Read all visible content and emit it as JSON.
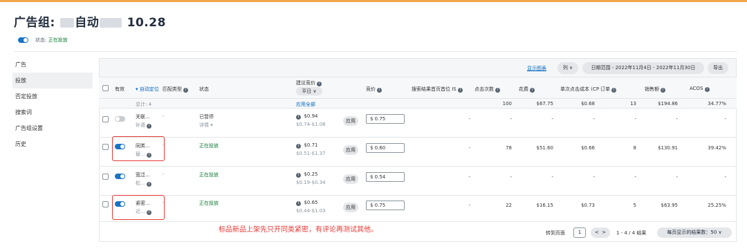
{
  "header": {
    "title_prefix": "广告组: ",
    "title_mid": "自动",
    "title_suffix": "10.28",
    "status_label": "状态: ",
    "status_value": "正在投放"
  },
  "sidebar": {
    "items": [
      {
        "label": "广告",
        "active": false
      },
      {
        "label": "投放",
        "active": true
      },
      {
        "label": "否定投放",
        "active": false
      },
      {
        "label": "搜索词",
        "active": false
      },
      {
        "label": "广告组设置",
        "active": false
      },
      {
        "label": "历史",
        "active": false
      }
    ]
  },
  "toolbar": {
    "show_chart": "显示图表",
    "columns": "列",
    "date_range": "日期范围 - 2022年11月4日 - 2022年11月30日",
    "export": "导出"
  },
  "table": {
    "headers": {
      "active": "有效",
      "auto_targeting": "▾ 自动定位",
      "match_type": "匹配类型",
      "status": "状态",
      "suggested_bid": "建议竞价",
      "bid_dropdown": "平日 ∨",
      "bid": "竞价",
      "top_of_search": "搜索结果首页首位 IS",
      "clicks": "点击次数",
      "spend": "花费",
      "cpc": "单次点击成本 (CPC)",
      "orders": "订单",
      "sales": "销售额",
      "acos": "ACOS"
    },
    "total": {
      "label": "总计: 4",
      "apply_all": "应用全部",
      "clicks": "100",
      "spend": "$67.75",
      "cpc": "$0.68",
      "orders": "13",
      "sales": "$194.86",
      "acos": "34.77%"
    },
    "rows": [
      {
        "active": false,
        "name1": "关联...",
        "name2": "补语",
        "match": "-",
        "status": "已暂停",
        "status_sub": "详情 ▾",
        "sug_bid": "$0.94",
        "sug_range": "$0.74-$1.08",
        "apply": "应用",
        "bid": "$  0.75",
        "top": "-",
        "clicks": "-",
        "spend": "-",
        "cpc": "-",
        "orders": "-",
        "sales": "-",
        "acos": "-"
      },
      {
        "active": true,
        "name1": "同类...",
        "name2": "替...",
        "match": "-",
        "status": "正在投放",
        "status_sub": "",
        "sug_bid": "$0.71",
        "sug_range": "$0.51-$1.37",
        "apply": "应用",
        "bid": "$  0.60",
        "top": "-",
        "clicks": "78",
        "spend": "$51.60",
        "cpc": "$0.66",
        "orders": "8",
        "sales": "$130.91",
        "acos": "39.42%"
      },
      {
        "active": true,
        "name1": "宽泛...",
        "name2": "松...",
        "match": "-",
        "status": "正在投放",
        "status_sub": "",
        "sug_bid": "$0.25",
        "sug_range": "$0.19-$0.34",
        "apply": "应用",
        "bid": "$  0.54",
        "top": "-",
        "clicks": "-",
        "spend": "-",
        "cpc": "-",
        "orders": "-",
        "sales": "-",
        "acos": "-"
      },
      {
        "active": true,
        "name1": "紧密...",
        "name2": "近...",
        "match": "-",
        "status": "正在投放",
        "status_sub": "",
        "sug_bid": "$0.65",
        "sug_range": "$0.44-$1.03",
        "apply": "应用",
        "bid": "$  0.75",
        "top": "-",
        "clicks": "22",
        "spend": "$16.15",
        "cpc": "$0.73",
        "orders": "5",
        "sales": "$63.95",
        "acos": "25.25%"
      }
    ]
  },
  "annotation": "标品新品上架先只开同类紧密，有评论再测试其他。",
  "pagination": {
    "goto_label": "转到页面",
    "page": "1",
    "prev": "<",
    "next": ">",
    "range": "1 - 4 / 4 结果",
    "per_page": "每页显示的结果数：50 ∨"
  }
}
